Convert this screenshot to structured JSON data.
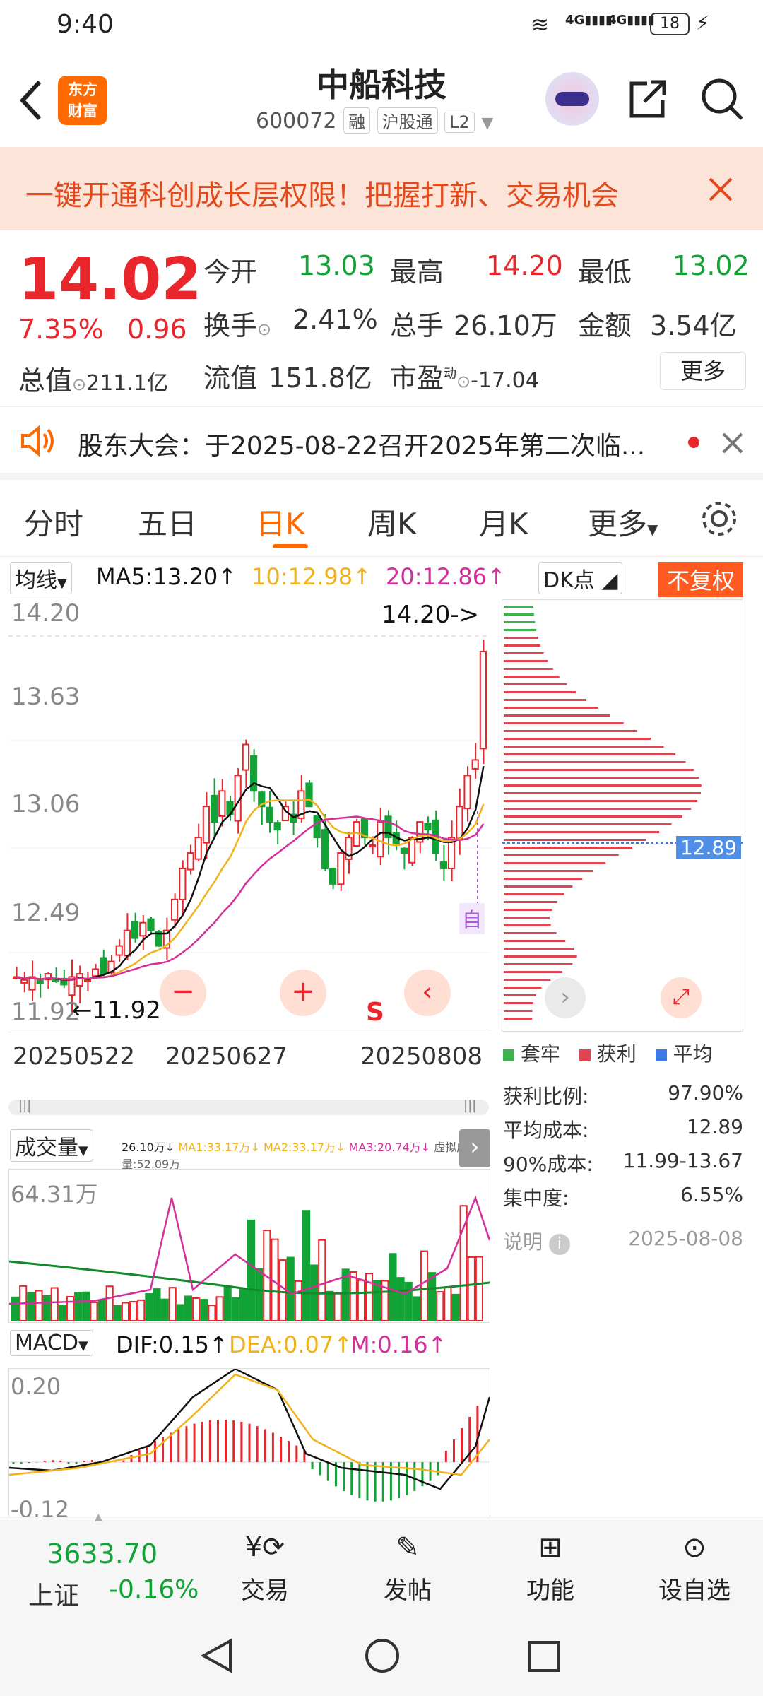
{
  "status": {
    "time": "9:40",
    "signal1": "4G",
    "signal2": "4G",
    "battery": "18"
  },
  "header": {
    "name": "中船科技",
    "code": "600072",
    "tag1": "融",
    "tag2": "沪股通",
    "tag3": "L2",
    "logo_line1": "东方",
    "logo_line2": "财富"
  },
  "banner": {
    "text": "一键开通科创成长层权限！把握打新、交易机会"
  },
  "quote": {
    "price": "14.02",
    "pct": "7.35%",
    "chg": "0.96",
    "open_label": "今开",
    "open": "13.03",
    "high_label": "最高",
    "high": "14.20",
    "low_label": "最低",
    "low": "13.02",
    "turnover_label": "换手",
    "turnover": "2.41%",
    "volume_label": "总手",
    "volume": "26.10万",
    "amount_label": "金额",
    "amount": "3.54亿",
    "mktcap_label": "总值",
    "mktcap": "211.1亿",
    "float_label": "流值",
    "float": "151.8亿",
    "pe_label": "市盈",
    "pe_sup": "动",
    "pe": "-17.04",
    "more": "更多"
  },
  "notice": {
    "text": "股东大会：于2025-08-22召开2025年第二次临..."
  },
  "tabs": [
    {
      "label": "分时"
    },
    {
      "label": "五日"
    },
    {
      "label": "日K"
    },
    {
      "label": "周K"
    },
    {
      "label": "月K"
    },
    {
      "label": "更多"
    }
  ],
  "ma_bar": {
    "sel": "均线",
    "ma5": "MA5:13.20↑",
    "ma10": "10:12.98↑",
    "ma20": "20:12.86↑",
    "dk": "DK点",
    "fq": "不复权"
  },
  "kchart": {
    "y_labels": [
      "14.20",
      "13.63",
      "13.06",
      "12.49",
      "11.92"
    ],
    "high_mark": "14.20->",
    "low_mark": "11.92",
    "dates": [
      "20250522",
      "20250627",
      "20250808"
    ],
    "s_mark": "S",
    "auto": "自"
  },
  "chip": {
    "avg": "12.89",
    "legend": [
      "套牢",
      "获利",
      "平均"
    ],
    "rows": [
      {
        "k": "获利比例:",
        "v": "97.90%"
      },
      {
        "k": "平均成本:",
        "v": "12.89"
      },
      {
        "k": "90%成本:",
        "v": "11.99-13.67"
      },
      {
        "k": "集中度:",
        "v": "6.55%"
      }
    ],
    "note": "说明",
    "date": "2025-08-08"
  },
  "vol": {
    "sel": "成交量",
    "info": "26.10万↓",
    "ma1": "MA1:33.17万↓",
    "ma2": "MA2:33.17万↓",
    "ma3": "MA3:20.74万↓",
    "virt": "虚拟成交量:52.09万",
    "max": "64.31万"
  },
  "macd": {
    "sel": "MACD",
    "dif": "DIF:0.15↑",
    "dea": "DEA:0.07↑",
    "m": "M:0.16↑",
    "top": "0.20",
    "bottom": "-0.12"
  },
  "bottom": {
    "index_val": "3633.70",
    "index_name": "上证",
    "index_pct": "-0.16%",
    "items": [
      {
        "label": "交易"
      },
      {
        "label": "发帖"
      },
      {
        "label": "功能"
      },
      {
        "label": "设自选"
      }
    ]
  },
  "colors": {
    "up": "#e8262b",
    "down": "#12a337",
    "accent": "#ff6a00",
    "ma5": "#111111",
    "ma10": "#f2b21a",
    "ma20": "#d42f9b"
  }
}
